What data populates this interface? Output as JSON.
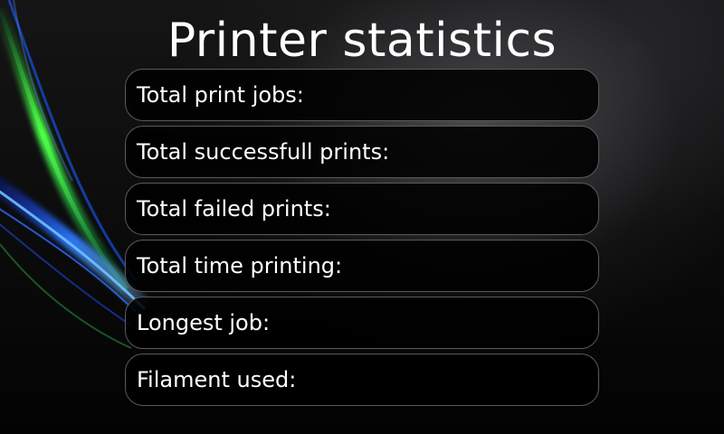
{
  "title": "Printer statistics",
  "stats": [
    {
      "label": "Total print jobs:",
      "value": ""
    },
    {
      "label": "Total successfull prints:",
      "value": ""
    },
    {
      "label": "Total failed prints:",
      "value": ""
    },
    {
      "label": "Total time printing:",
      "value": ""
    },
    {
      "label": "Longest job:",
      "value": ""
    },
    {
      "label": "Filament used:",
      "value": ""
    }
  ],
  "colors": {
    "background": "#000000",
    "text": "#ffffff",
    "row_border": "#5a5a5e",
    "accent_green": "#39d43a",
    "accent_blue": "#1f6cff"
  }
}
